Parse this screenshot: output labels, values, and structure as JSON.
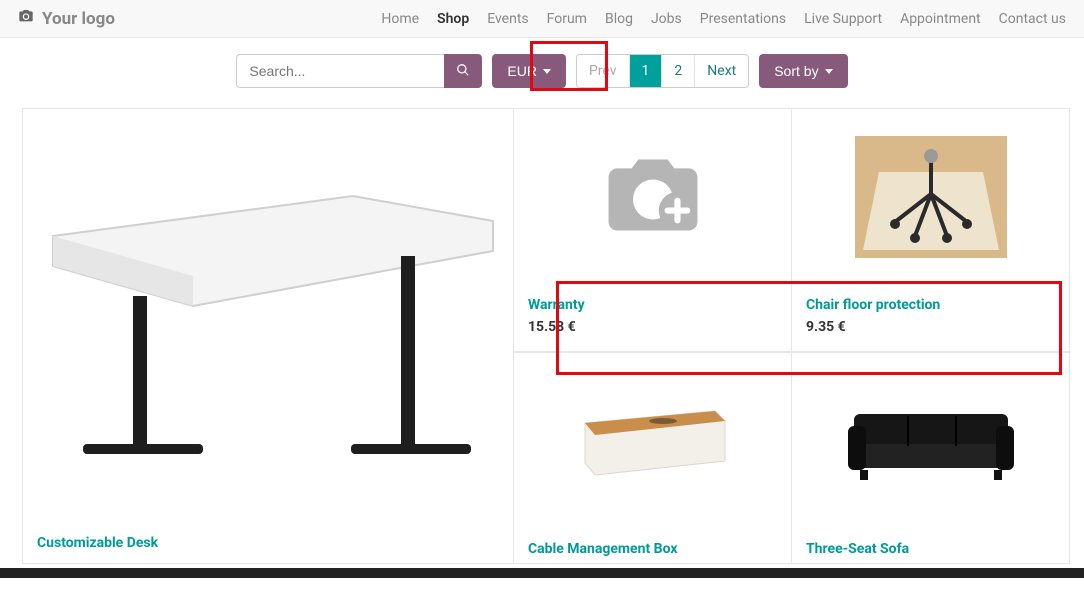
{
  "header": {
    "logo_text": "Your logo",
    "nav": [
      {
        "label": "Home",
        "active": false
      },
      {
        "label": "Shop",
        "active": true
      },
      {
        "label": "Events",
        "active": false
      },
      {
        "label": "Forum",
        "active": false
      },
      {
        "label": "Blog",
        "active": false
      },
      {
        "label": "Jobs",
        "active": false
      },
      {
        "label": "Presentations",
        "active": false
      },
      {
        "label": "Live Support",
        "active": false
      },
      {
        "label": "Appointment",
        "active": false
      },
      {
        "label": "Contact us",
        "active": false
      }
    ]
  },
  "toolbar": {
    "search_placeholder": "Search...",
    "currency_label": "EUR",
    "pager": {
      "prev": "Prev",
      "next": "Next",
      "pages": [
        "1",
        "2"
      ],
      "active": "1"
    },
    "sort_label": "Sort by"
  },
  "products": {
    "big": {
      "title": "Customizable Desk"
    },
    "warranty": {
      "title": "Warranty",
      "price": "15.58 €"
    },
    "chairmat": {
      "title": "Chair floor protection",
      "price": "9.35 €"
    },
    "cablebox": {
      "title": "Cable Management Box"
    },
    "sofa": {
      "title": "Three-Seat Sofa"
    }
  }
}
